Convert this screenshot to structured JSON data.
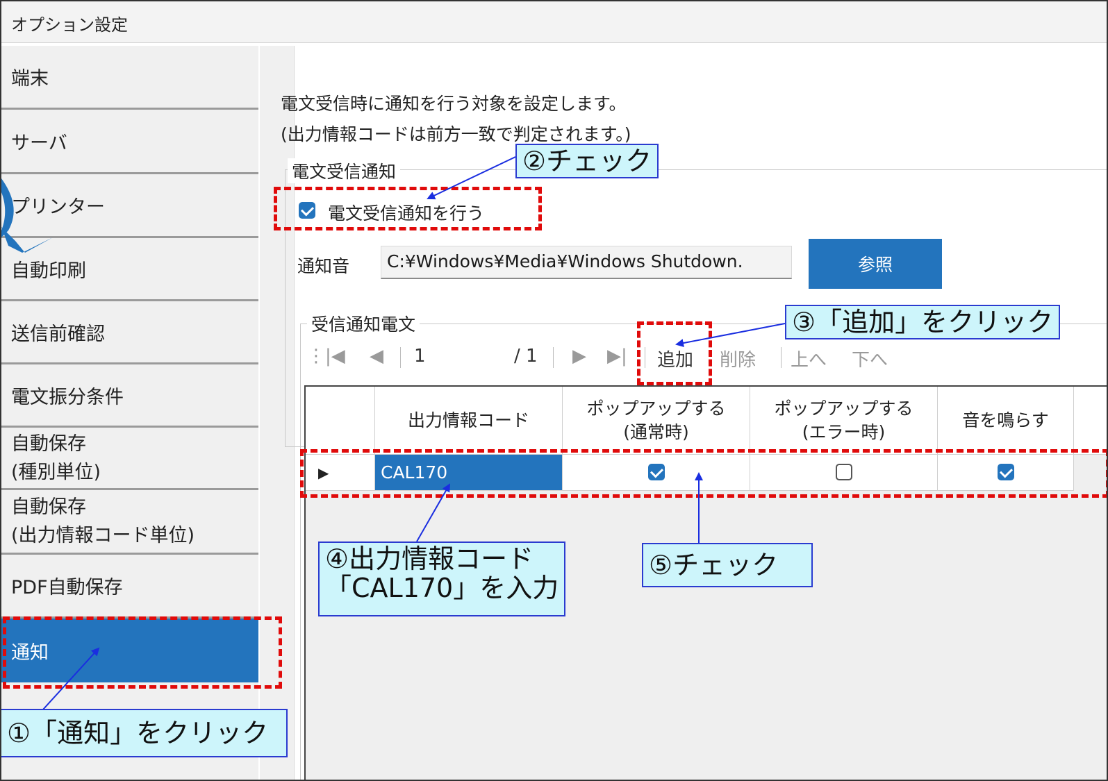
{
  "window": {
    "title": "オプション設定"
  },
  "sidebar": {
    "items": [
      {
        "label": "端末"
      },
      {
        "label": "サーバ"
      },
      {
        "label": "プリンター"
      },
      {
        "label": "自動印刷"
      },
      {
        "label": "送信前確認"
      },
      {
        "label": "電文振分条件"
      },
      {
        "label": "自動保存",
        "label2": "(種別単位)"
      },
      {
        "label": "自動保存",
        "label2": "(出力情報コード単位)"
      },
      {
        "label": "PDF自動保存"
      },
      {
        "label": "通知",
        "active": true
      }
    ]
  },
  "main": {
    "description_line1": "電文受信時に通知を行う対象を設定します。",
    "description_line2": "(出力情報コードは前方一致で判定されます。)",
    "notify_group": {
      "title": "電文受信通知",
      "enable_checkbox_label": "電文受信通知を行う",
      "enable_checked": true,
      "sound_label": "通知音",
      "sound_path": "C:¥Windows¥Media¥Windows Shutdown.",
      "browse_button": "参照"
    },
    "message_group": {
      "title": "受信通知電文",
      "toolbar": {
        "first": "|◀",
        "prev": "◀",
        "page": "1",
        "total": "/ 1",
        "next": "▶",
        "last": "▶|",
        "add": "追加",
        "delete": "削除",
        "up": "上へ",
        "down": "下へ"
      },
      "grid": {
        "columns": [
          "",
          "出力情報コード",
          "ポップアップする\n(通常時)",
          "ポップアップする\n(エラー時)",
          "音を鳴らす"
        ],
        "rows": [
          {
            "marker": "▶",
            "code": "CAL170",
            "popup_normal": true,
            "popup_error": false,
            "sound": true
          }
        ]
      }
    }
  },
  "annotations": {
    "step1": "①「通知」をクリック",
    "step2": "②チェック",
    "step3": "③「追加」をクリック",
    "step4_line1": "④出力情報コード",
    "step4_line2": "「CAL170」を入力",
    "step5": "⑤チェック",
    "highlight_color": "#e00b0b",
    "callout_bg": "#cdf5fb",
    "callout_border": "#2a3bd0"
  },
  "colors": {
    "accent": "#2374bd"
  }
}
